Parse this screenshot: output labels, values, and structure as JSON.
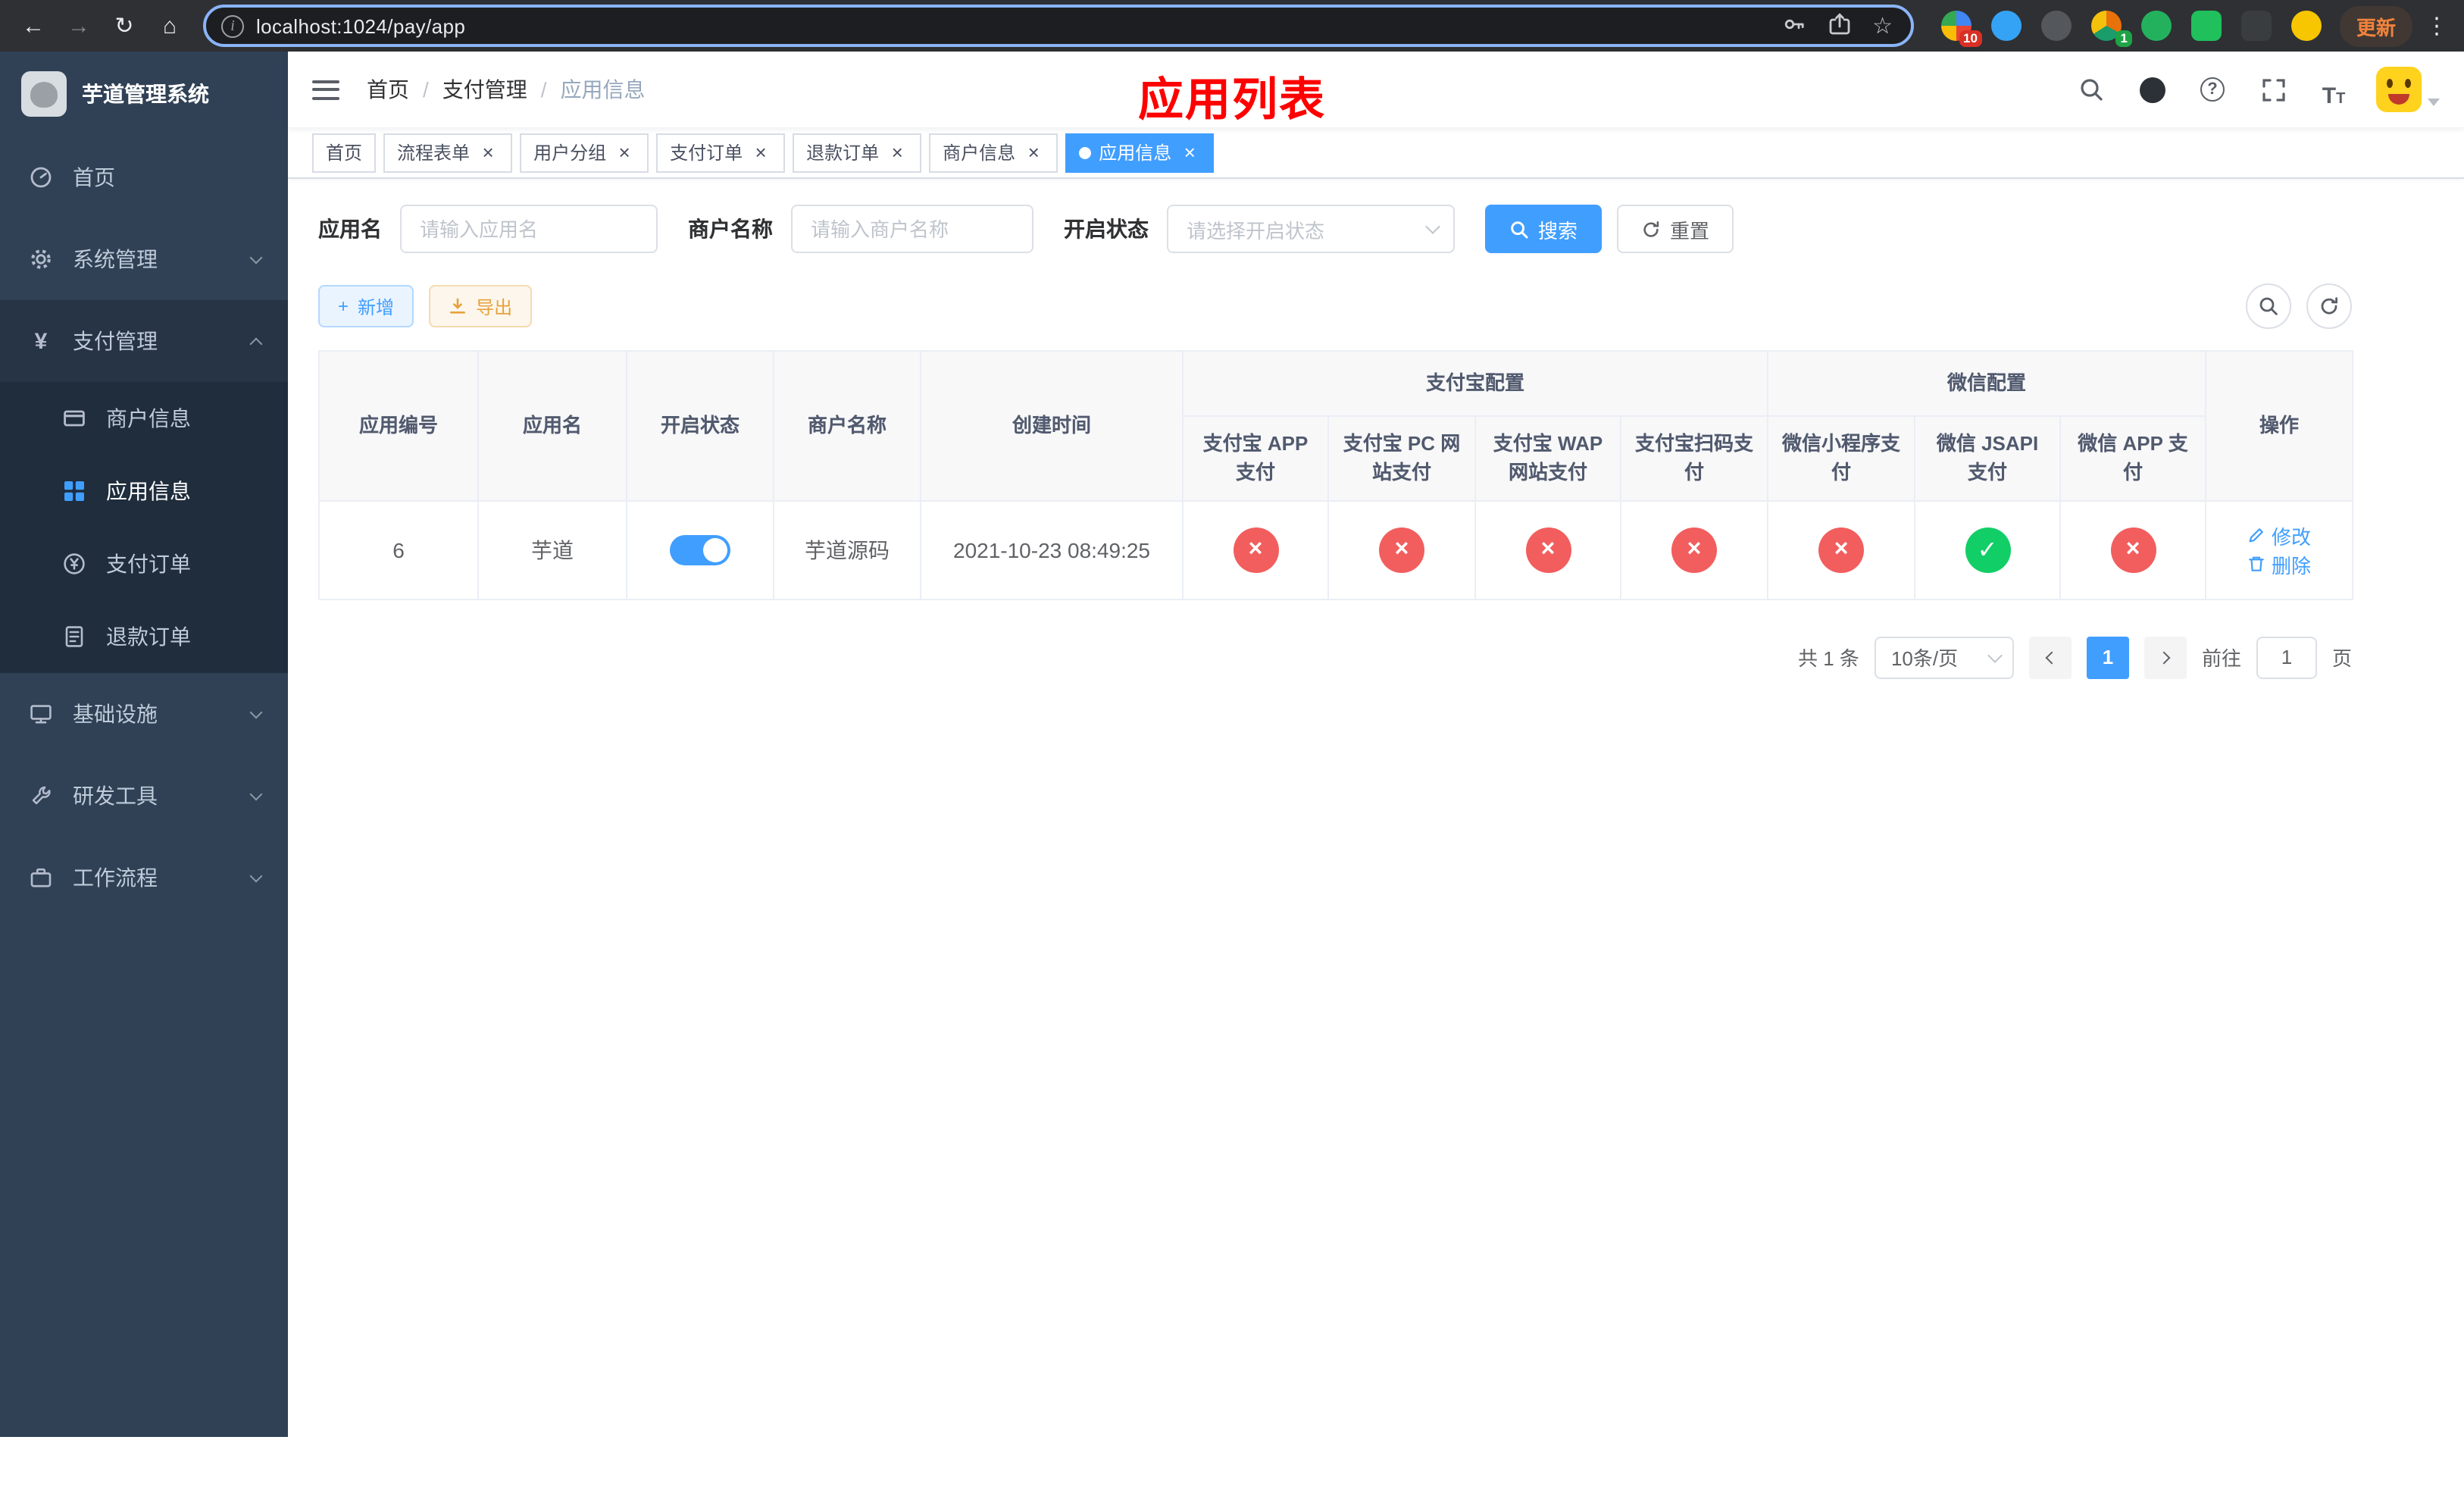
{
  "browser": {
    "url": "localhost:1024/pay/app",
    "update_button": "更新",
    "extension_badges": [
      "10",
      "1"
    ]
  },
  "icons": {
    "back": "←",
    "forward": "→",
    "reload": "↻",
    "home": "⌂",
    "star": "☆",
    "menu_dots": "⋮",
    "info": "i",
    "close": "×",
    "yen": "¥",
    "plus": "+",
    "question": "?",
    "font_large": "T",
    "font_small": "T"
  },
  "sidebar": {
    "title": "芋道管理系统",
    "items": [
      {
        "label": "首页"
      },
      {
        "label": "系统管理"
      },
      {
        "label": "支付管理",
        "children": [
          {
            "label": "商户信息"
          },
          {
            "label": "应用信息"
          },
          {
            "label": "支付订单"
          },
          {
            "label": "退款订单"
          }
        ]
      },
      {
        "label": "基础设施"
      },
      {
        "label": "研发工具"
      },
      {
        "label": "工作流程"
      }
    ]
  },
  "navbar": {
    "breadcrumb": [
      "首页",
      "支付管理",
      "应用信息"
    ],
    "separator": "/",
    "page_title": "应用列表"
  },
  "tabs": [
    {
      "label": "首页"
    },
    {
      "label": "流程表单"
    },
    {
      "label": "用户分组"
    },
    {
      "label": "支付订单"
    },
    {
      "label": "退款订单"
    },
    {
      "label": "商户信息"
    },
    {
      "label": "应用信息"
    }
  ],
  "filters": {
    "app_name_label": "应用名",
    "app_name_placeholder": "请输入应用名",
    "merchant_name_label": "商户名称",
    "merchant_name_placeholder": "请输入商户名称",
    "status_label": "开启状态",
    "status_placeholder": "请选择开启状态",
    "search_button": "搜索",
    "reset_button": "重置"
  },
  "toolbar": {
    "add_button": "新增",
    "export_button": "导出"
  },
  "table": {
    "columns": [
      "应用编号",
      "应用名",
      "开启状态",
      "商户名称",
      "创建时间"
    ],
    "group_alipay": "支付宝配置",
    "alipay_columns": [
      "支付宝 APP 支付",
      "支付宝 PC 网站支付",
      "支付宝 WAP 网站支付",
      "支付宝扫码支付"
    ],
    "group_wechat": "微信配置",
    "wechat_columns": [
      "微信小程序支付",
      "微信 JSAPI 支付",
      "微信 APP 支付"
    ],
    "actions_column": "操作",
    "rows": [
      {
        "id": "6",
        "name": "芋道",
        "status_on": true,
        "merchant": "芋道源码",
        "created": "2021-10-23 08:49:25",
        "alipay": [
          "no",
          "no",
          "no",
          "no"
        ],
        "wechat": [
          "no",
          "yes",
          "no"
        ],
        "edit_label": "修改",
        "delete_label": "删除"
      }
    ]
  },
  "pagination": {
    "total": "共 1 条",
    "page_size": "10条/页",
    "current_page": "1",
    "goto_prefix": "前往",
    "goto_value": "1",
    "goto_suffix": "页"
  }
}
